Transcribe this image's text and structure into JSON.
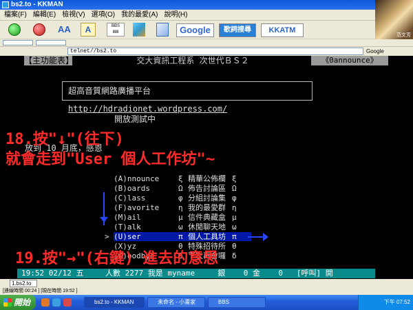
{
  "window": {
    "title": "bs2.to - KKMAN"
  },
  "menu": [
    "檔案(F)",
    "編輯(E)",
    "檢視(V)",
    "選項(O)",
    "我的最愛(A)",
    "說明(H)"
  ],
  "toolbar": {
    "google_label": "Google",
    "lyric_label": "歌詞搜尋",
    "kkatm_label": "KKATM"
  },
  "avatar_caption": "范文芳",
  "address": {
    "value": "telnet//bs2.to",
    "google_box": "Google"
  },
  "terminal": {
    "header_left": "【主功能表】",
    "header_center": "交大資訊工程系 次世代ＢＳ２",
    "header_right": "《0announce》",
    "banner_text": "超高音質網路廣播平台 ",
    "banner_url": "http://hdradionet.wordpress.com/",
    "testing": "開放測試中",
    "notice": "放到 10 月底，感恩",
    "menu_items": [
      {
        "key": "(A)",
        "en": "nnounce",
        "sym": "ξ",
        "zh": "精華公佈欄",
        "sym2": "ξ"
      },
      {
        "key": "(B)",
        "en": "oards",
        "sym": "Ω",
        "zh": "佈告討論區",
        "sym2": "Ω"
      },
      {
        "key": "(C)",
        "en": "lass",
        "sym": "φ",
        "zh": "分組討論集",
        "sym2": "φ"
      },
      {
        "key": "(F)",
        "en": "avorite",
        "sym": "η",
        "zh": "我的最愛群",
        "sym2": "η"
      },
      {
        "key": "(M)",
        "en": "ail",
        "sym": "μ",
        "zh": "信件典藏盒",
        "sym2": "μ"
      },
      {
        "key": "(T)",
        "en": "alk",
        "sym": "ω",
        "zh": "休閒聊天地",
        "sym2": "ω"
      },
      {
        "key": "(U)",
        "en": "ser",
        "sym": "π",
        "zh": "個人工具坊",
        "sym2": "π"
      },
      {
        "key": "(X)",
        "en": "yz",
        "sym": "θ",
        "zh": "特殊招待所",
        "sym2": "θ"
      },
      {
        "key": "(G)",
        "en": "oodbye",
        "sym": "δ",
        "zh": "下次再會囉",
        "sym2": "δ"
      }
    ],
    "cursor": ">",
    "status_time": "19:52 02/12 五",
    "status_rest": "人數 2277 我是 myname     銀    0 金    0   [呼叫] 開"
  },
  "annotations": {
    "step18_line1": "18.按\"↓\"(往下)",
    "step18_line2": "就會走到\"User 個人工作坊\"~",
    "step19": "19.按\"→\"(右鍵) 進去的意思"
  },
  "session_tab": "1.bs2.to",
  "statusbar": "[連線時間 00:24 ] [現在時間 19:52 ]",
  "taskbar": {
    "start": "開始",
    "tasks": [
      "bs2.to - KKMAN",
      "未命名 - 小畫家",
      "BBS"
    ],
    "clock": "下午 07:52"
  },
  "colors": {
    "terminal_bg": "#000000",
    "annotation_red": "#ff2a2a",
    "arrow_blue": "#2846ff",
    "selection_blue": "#0018a8",
    "status_teal": "#0a8a8a"
  }
}
